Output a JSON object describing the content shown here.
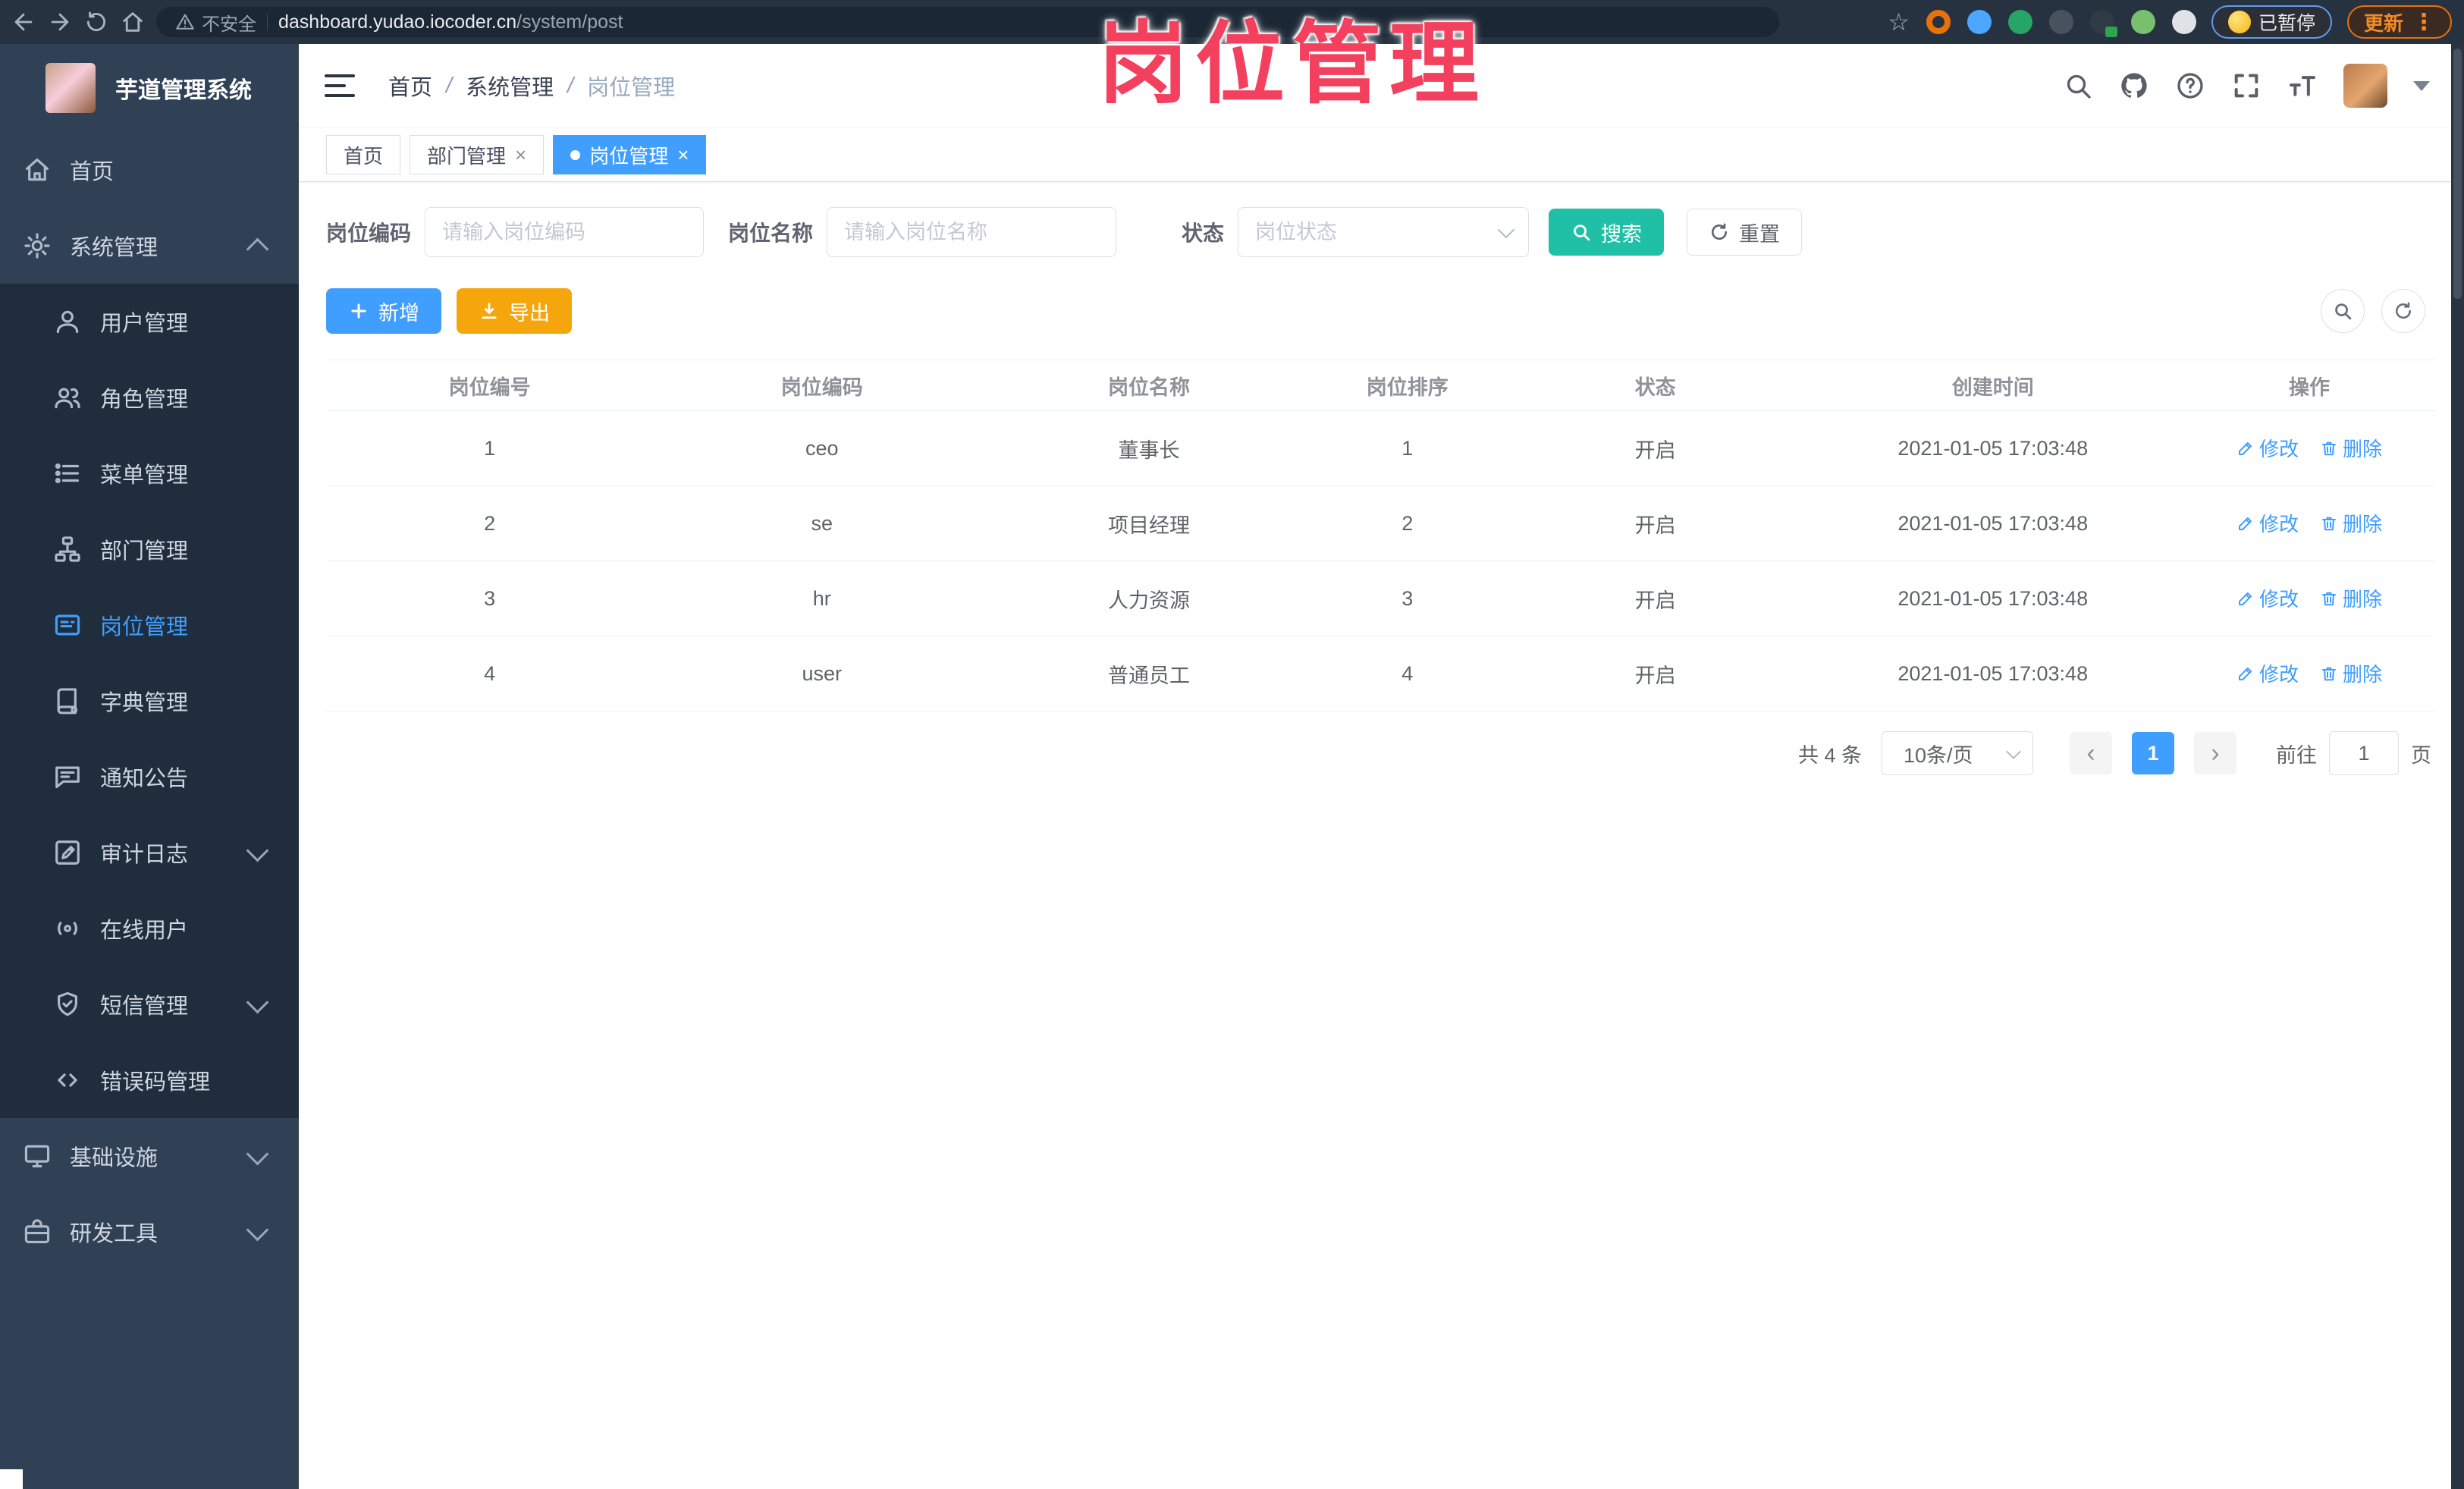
{
  "colors": {
    "accent": "#409eff",
    "search_button": "#1fc0a5",
    "export_button": "#f5a60d",
    "annotation": "#f2405e",
    "sidebar_bg": "#304156",
    "submenu_bg": "#1f2d3d",
    "browser_bar": "#263240",
    "update_button": "#e8710a"
  },
  "annotation": {
    "text": "岗位管理"
  },
  "browser": {
    "security_label": "不安全",
    "url_host": "dashboard.yudao.iocoder.cn",
    "url_path": "/system/post",
    "paused_badge": "已暂停",
    "update_button": "更新",
    "extensions": [
      {
        "name": "bookmark-star-icon",
        "style": "star"
      },
      {
        "name": "ext-orange-ring-icon",
        "style": "ring",
        "color": "#e8710a"
      },
      {
        "name": "ext-blue-pin-icon",
        "style": "disc",
        "color": "#4da6ff"
      },
      {
        "name": "ext-green-check-icon",
        "style": "disc",
        "color": "#27a567"
      },
      {
        "name": "ext-sliders-icon",
        "style": "disc",
        "color": "#47525e"
      },
      {
        "name": "ext-gtm-icon",
        "style": "disc",
        "color": "#2f3a44",
        "badge": "#2da44e"
      },
      {
        "name": "ext-green-leaf-icon",
        "style": "disc",
        "color": "#79c06e"
      },
      {
        "name": "ext-puzzle-icon",
        "style": "disc",
        "color": "#dfe3e8"
      }
    ]
  },
  "sidebar": {
    "title": "芋道管理系统",
    "items": [
      {
        "name": "home",
        "label": "首页",
        "icon": "home-icon",
        "level": "top"
      },
      {
        "name": "system-management",
        "label": "系统管理",
        "icon": "gear-icon",
        "level": "top",
        "arrow": "up"
      },
      {
        "name": "user-management",
        "label": "用户管理",
        "icon": "user-icon",
        "level": "sub"
      },
      {
        "name": "role-management",
        "label": "角色管理",
        "icon": "roles-icon",
        "level": "sub"
      },
      {
        "name": "menu-management",
        "label": "菜单管理",
        "icon": "menu-list-icon",
        "level": "sub"
      },
      {
        "name": "dept-management",
        "label": "部门管理",
        "icon": "dept-tree-icon",
        "level": "sub"
      },
      {
        "name": "post-management",
        "label": "岗位管理",
        "icon": "post-card-icon",
        "level": "sub",
        "active": true
      },
      {
        "name": "dict-management",
        "label": "字典管理",
        "icon": "dict-book-icon",
        "level": "sub"
      },
      {
        "name": "notice-management",
        "label": "通知公告",
        "icon": "notice-icon",
        "level": "sub"
      },
      {
        "name": "audit-log",
        "label": "审计日志",
        "icon": "audit-log-icon",
        "level": "sub",
        "arrow": "down"
      },
      {
        "name": "online-users",
        "label": "在线用户",
        "icon": "online-users-icon",
        "level": "sub"
      },
      {
        "name": "sms-management",
        "label": "短信管理",
        "icon": "sms-shield-icon",
        "level": "sub",
        "arrow": "down"
      },
      {
        "name": "error-code-management",
        "label": "错误码管理",
        "icon": "error-code-icon",
        "level": "sub"
      },
      {
        "name": "infrastructure",
        "label": "基础设施",
        "icon": "infra-monitor-icon",
        "level": "top",
        "arrow": "down"
      },
      {
        "name": "dev-tools",
        "label": "研发工具",
        "icon": "devtools-icon",
        "level": "top",
        "arrow": "down"
      }
    ]
  },
  "header": {
    "breadcrumb": [
      "首页",
      "系统管理",
      "岗位管理"
    ],
    "separator": "/"
  },
  "tabs": [
    {
      "label": "首页",
      "active": false,
      "closable": false
    },
    {
      "label": "部门管理",
      "active": false,
      "closable": true
    },
    {
      "label": "岗位管理",
      "active": true,
      "closable": true
    }
  ],
  "filters": {
    "code_label": "岗位编码",
    "code_placeholder": "请输入岗位编码",
    "name_label": "岗位名称",
    "name_placeholder": "请输入岗位名称",
    "status_label": "状态",
    "status_placeholder": "岗位状态",
    "search_label": "搜索",
    "reset_label": "重置"
  },
  "toolbar": {
    "add_label": "新增",
    "export_label": "导出"
  },
  "table": {
    "headers": [
      "岗位编号",
      "岗位编码",
      "岗位名称",
      "岗位排序",
      "状态",
      "创建时间",
      "操作"
    ],
    "rows": [
      {
        "id": "1",
        "code": "ceo",
        "name": "董事长",
        "sort": "1",
        "status": "开启",
        "created": "2021-01-05 17:03:48"
      },
      {
        "id": "2",
        "code": "se",
        "name": "项目经理",
        "sort": "2",
        "status": "开启",
        "created": "2021-01-05 17:03:48"
      },
      {
        "id": "3",
        "code": "hr",
        "name": "人力资源",
        "sort": "3",
        "status": "开启",
        "created": "2021-01-05 17:03:48"
      },
      {
        "id": "4",
        "code": "user",
        "name": "普通员工",
        "sort": "4",
        "status": "开启",
        "created": "2021-01-05 17:03:48"
      }
    ],
    "edit_label": "修改",
    "delete_label": "删除"
  },
  "pagination": {
    "total": "共 4 条",
    "page_size": "10条/页",
    "current": "1",
    "goto_label": "前往",
    "goto_value": "1",
    "unit_label": "页"
  }
}
